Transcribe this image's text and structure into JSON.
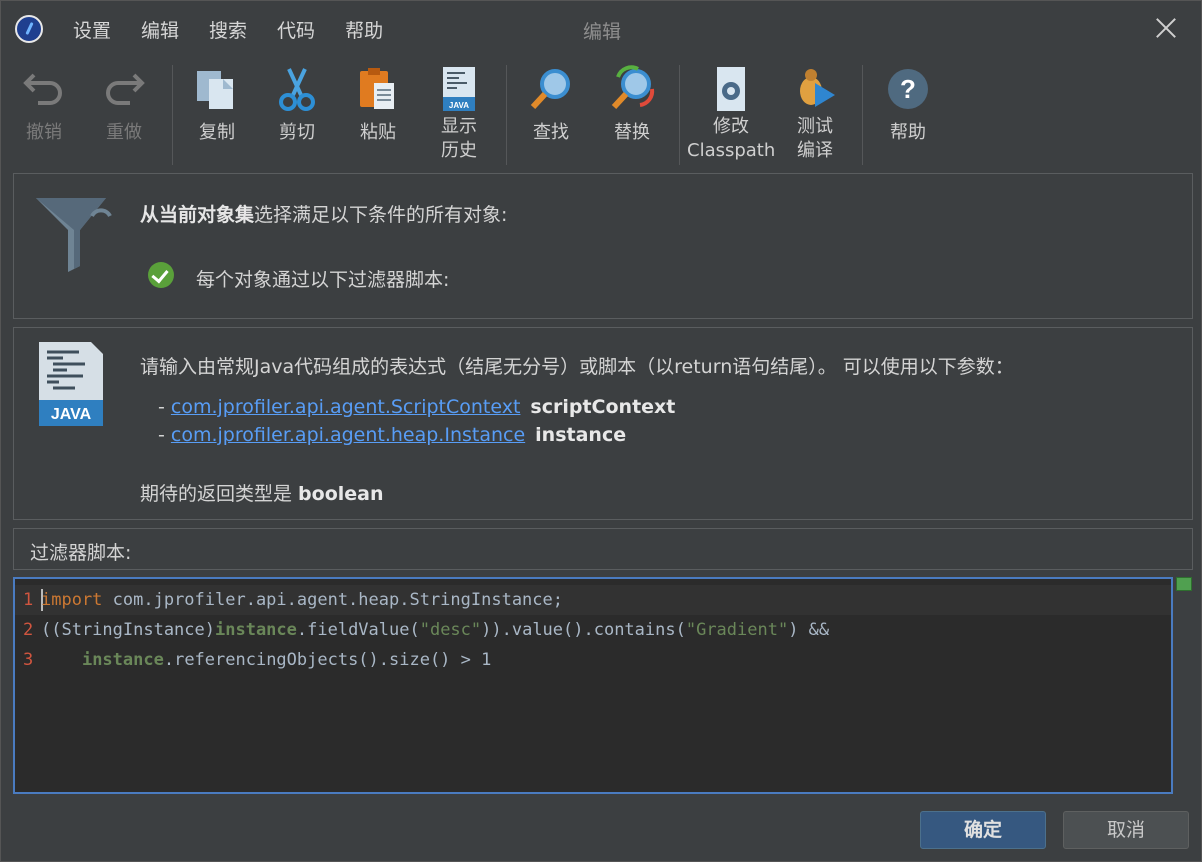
{
  "window": {
    "title": "编辑",
    "menu": [
      "设置",
      "编辑",
      "搜索",
      "代码",
      "帮助"
    ]
  },
  "toolbar": {
    "undo": "撤销",
    "redo": "重做",
    "copy": "复制",
    "cut": "剪切",
    "paste": "粘贴",
    "history_line1": "显示",
    "history_line2": "历史",
    "find": "查找",
    "replace": "替换",
    "classpath_line1": "修改",
    "classpath_line2": "Classpath",
    "compile_line1": "测试",
    "compile_line2": "编译",
    "help": "帮助"
  },
  "filter_panel": {
    "heading_bold": "从当前对象集",
    "heading_rest": "选择满足以下条件的所有对象:",
    "condition": "每个对象通过以下过滤器脚本:"
  },
  "info_panel": {
    "description": "请输入由常规Java代码组成的表达式（结尾无分号）或脚本（以return语句结尾）。 可以使用以下参数：",
    "params": [
      {
        "dash": "- ",
        "type": "com.jprofiler.api.agent.ScriptContext",
        "name": "scriptContext"
      },
      {
        "dash": "- ",
        "type": "com.jprofiler.api.agent.heap.Instance",
        "name": "instance"
      }
    ],
    "return_prefix": "期待的返回类型是 ",
    "return_type": "boolean"
  },
  "script_label": "过滤器脚本:",
  "editor": {
    "lines": [
      {
        "num": "1",
        "tokens": [
          [
            "kw",
            "import"
          ],
          [
            "",
            " com.jprofiler.api.agent.heap.StringInstance;"
          ]
        ]
      },
      {
        "num": "2",
        "tokens": [
          [
            "",
            "((StringInstance)"
          ],
          [
            "idg",
            "instance"
          ],
          [
            "",
            ".fieldValue("
          ],
          [
            "str",
            "\"desc\""
          ],
          [
            "",
            ")).value().contains("
          ],
          [
            "str",
            "\"Gradient\""
          ],
          [
            "",
            ") &&"
          ]
        ]
      },
      {
        "num": "3",
        "tokens": [
          [
            "",
            "    "
          ],
          [
            "idg",
            "instance"
          ],
          [
            "",
            ".referencingObjects().size() > 1"
          ]
        ]
      }
    ]
  },
  "buttons": {
    "ok": "确定",
    "cancel": "取消"
  },
  "colors": {
    "background": "#3c3f41",
    "editor_bg": "#2b2b2b",
    "link": "#589df6",
    "keyword": "#cc7832",
    "string": "#6a8759",
    "primary_button": "#365880"
  }
}
